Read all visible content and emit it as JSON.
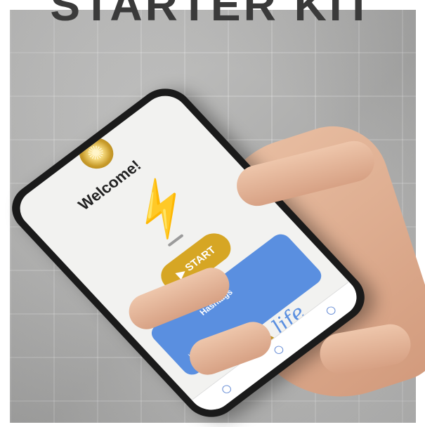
{
  "header": {
    "banner_text": "STARTER KIT"
  },
  "app": {
    "welcome": "Welcome!",
    "start_label": "▶ START",
    "card": {
      "title": "Hashtags",
      "subtitle": "Hashtags"
    },
    "signature": "life"
  },
  "colors": {
    "accent_gold": "#d6a624",
    "card_blue": "#5a8fe0",
    "bolt_yellow": "#f0b324"
  },
  "icons": [
    "lightning-bolt-icon",
    "gold-star-logo",
    "nav-home-icon",
    "nav-profile-icon"
  ]
}
